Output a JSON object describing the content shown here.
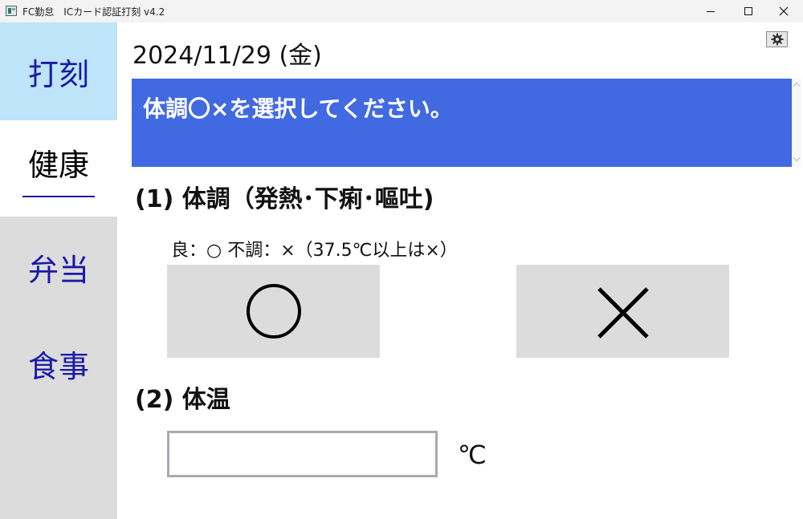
{
  "window": {
    "title": "FC勤怠　ICカード認証打刻 v4.2"
  },
  "sidebar": {
    "items": [
      {
        "label": "打刻"
      },
      {
        "label": "健康"
      },
      {
        "label": "弁当"
      },
      {
        "label": "食事"
      }
    ]
  },
  "main": {
    "date": "2024/11/29 (金)",
    "banner": "体調〇×を選択してください。",
    "section1": {
      "heading": "(1) 体調（発熱･下痢･嘔吐)",
      "hint": "良：○  不調：×（37.5℃以上は×）",
      "ok_label": "〇",
      "ng_label": "×"
    },
    "section2": {
      "heading": "(2) 体温",
      "value": "",
      "unit": "℃"
    }
  },
  "colors": {
    "banner": "#4169e1",
    "sidebar_active": "#bde4f8",
    "sidebar_bg": "#dcdcdc",
    "nav_text": "#1a1aa8"
  },
  "icons": {
    "settings": "gear-icon"
  }
}
